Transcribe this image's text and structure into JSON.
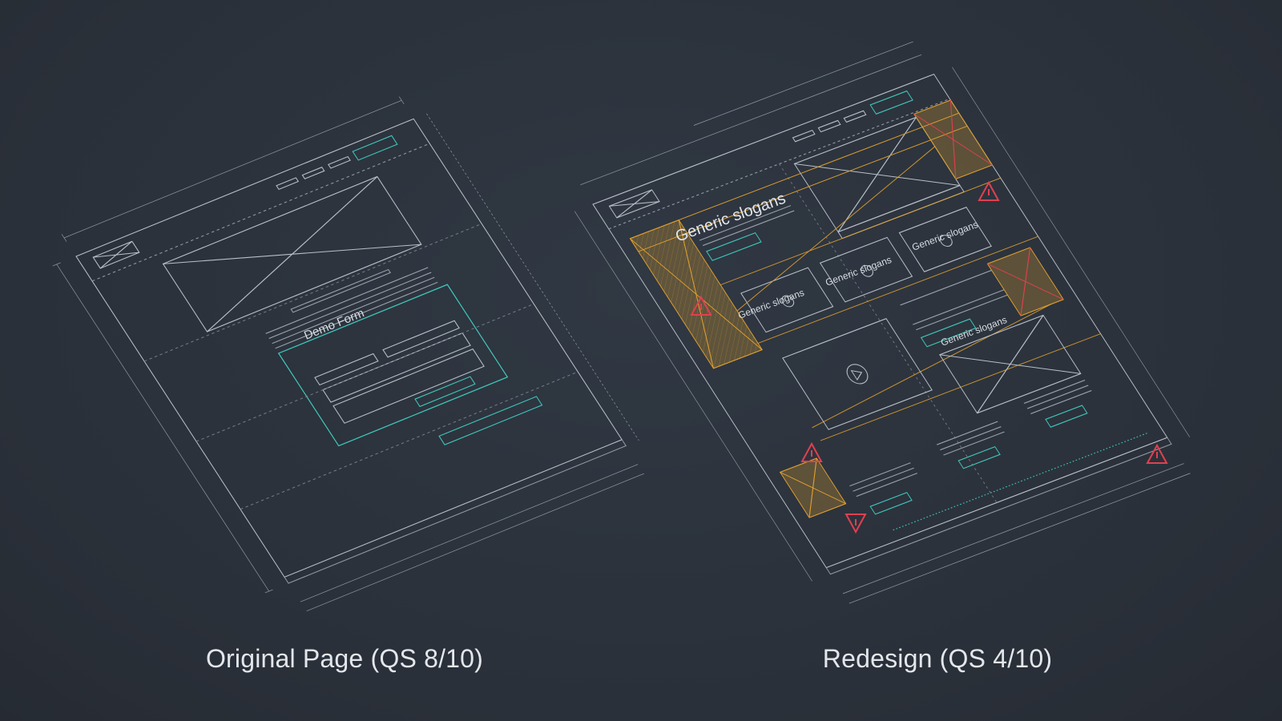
{
  "captions": {
    "original": "Original Page (QS 8/10)",
    "redesign": "Redesign (QS 4/10)"
  },
  "original_page": {
    "form_title": "Demo Form"
  },
  "redesign_page": {
    "hero_slogan": "Generic slogans",
    "card_slogans": [
      "Generic slogans",
      "Generic slogans",
      "Generic slogans"
    ],
    "feature_slogan": "Generic slogans"
  },
  "colors": {
    "background": "#2b323c",
    "line": "#b9c0c8",
    "accent_teal": "#3fc9bd",
    "warning_orange": "#e0a030",
    "warning_red": "#e04050"
  },
  "icons": [
    "image-placeholder-icon",
    "play-icon",
    "warning-triangle-icon"
  ]
}
